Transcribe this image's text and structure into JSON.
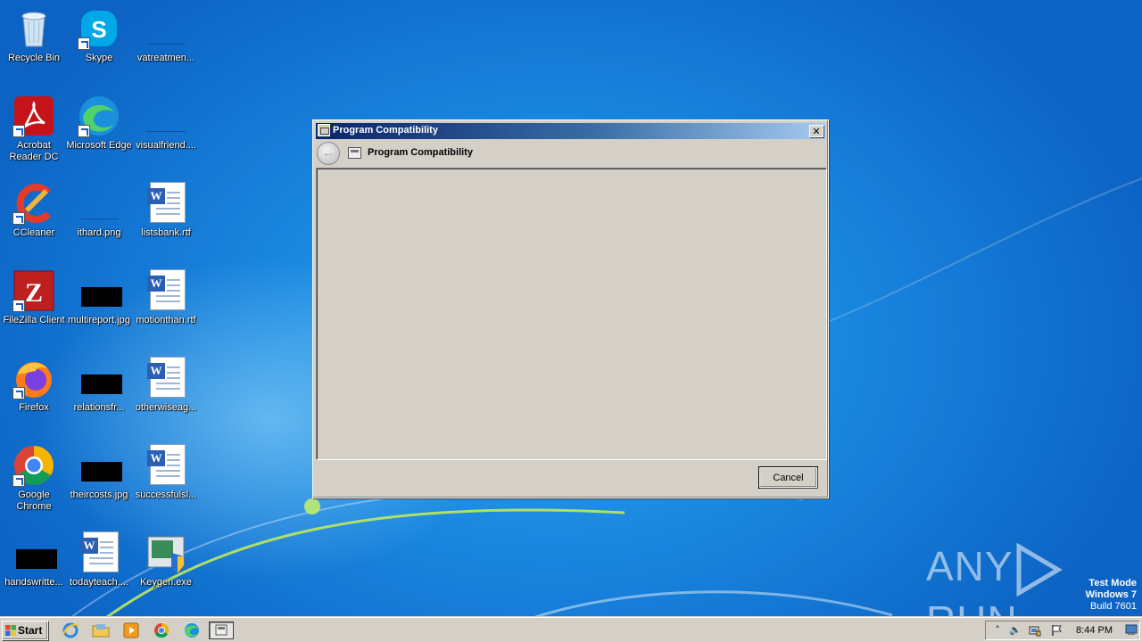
{
  "desktop": {
    "icons": [
      {
        "label": "Recycle Bin",
        "icon": "recycle-bin-icon"
      },
      {
        "label": "Skype",
        "icon": "skype-icon"
      },
      {
        "label": "vatreatmen...",
        "icon": "file-icon"
      },
      {
        "label": "Acrobat Reader DC",
        "icon": "acrobat-icon"
      },
      {
        "label": "Microsoft Edge",
        "icon": "edge-icon"
      },
      {
        "label": "visualfriend....",
        "icon": "file-icon"
      },
      {
        "label": "CCleaner",
        "icon": "ccleaner-icon"
      },
      {
        "label": "ithard.png",
        "icon": "image-icon"
      },
      {
        "label": "listsbank.rtf",
        "icon": "word-doc-icon"
      },
      {
        "label": "FileZilla Client",
        "icon": "filezilla-icon"
      },
      {
        "label": "multireport.jpg",
        "icon": "image-icon"
      },
      {
        "label": "motionthan.rtf",
        "icon": "word-doc-icon"
      },
      {
        "label": "Firefox",
        "icon": "firefox-icon"
      },
      {
        "label": "relationsfr...",
        "icon": "image-icon"
      },
      {
        "label": "otherwiseag...",
        "icon": "word-doc-icon"
      },
      {
        "label": "Google Chrome",
        "icon": "chrome-icon"
      },
      {
        "label": "theircosts.jpg",
        "icon": "image-icon"
      },
      {
        "label": "successfulsl...",
        "icon": "word-doc-icon"
      },
      {
        "label": "handswritte...",
        "icon": "image-icon"
      },
      {
        "label": "todayteach....",
        "icon": "word-doc-icon"
      },
      {
        "label": "Keygen.exe",
        "icon": "installer-icon"
      }
    ]
  },
  "dialog": {
    "title": "Program Compatibility",
    "nav_title": "Program Compatibility",
    "close_label": "✕",
    "back_label": "←",
    "cancel_label": "Cancel"
  },
  "watermark": {
    "brand": "ANY",
    "brand2": "RUN",
    "line1": "Test Mode",
    "line2": "Windows 7",
    "line3": "Build 7601"
  },
  "taskbar": {
    "start_label": "Start",
    "clock": "8:44 PM",
    "tray_expand": "˄",
    "tray_volume": "🔈"
  },
  "colors": {
    "desktop_bg": "#1a88e0",
    "dialog_face": "#d4d0c8",
    "titlebar_start": "#0a246a",
    "titlebar_end": "#a6caf0"
  }
}
